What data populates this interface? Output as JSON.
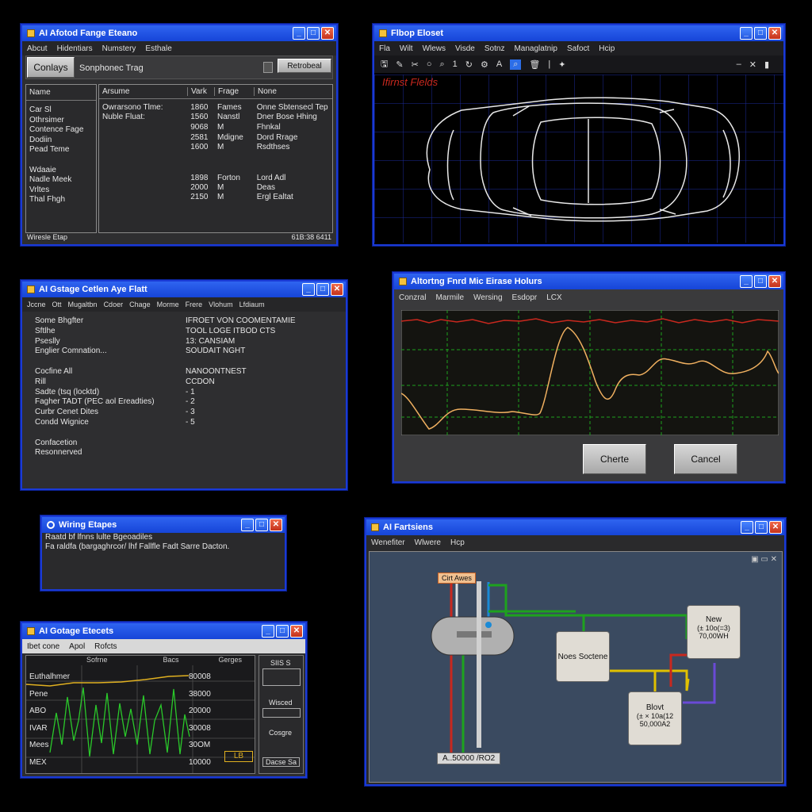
{
  "w1": {
    "title": "AI Afotod Fange Eteano",
    "menu": [
      "Abcut",
      "Hidentiars",
      "Numstery",
      "Esthale"
    ],
    "tab_left": "Conlays",
    "tab_mid": "Sonphonec Trag",
    "tab_right": "Retrobeal",
    "col_name": "Name",
    "list_left": [
      "Car Sl",
      "Othrsimer",
      "Contence Fage",
      "Dodiin",
      "Pead Teme",
      "",
      "Wdaaie",
      "Nadle Meek",
      "Vrltes",
      "Thal Fhgh"
    ],
    "headers": [
      "Arsume",
      "Vark",
      "Frage",
      "None"
    ],
    "rows": [
      [
        "Owrarsono Tlme:",
        "1860",
        "Fames",
        "Onne Sbtensecl Tep"
      ],
      [
        "Nuble Fluat:",
        "1560",
        "Nanstl",
        "Dner Bose Hhing"
      ],
      [
        "",
        "9068",
        "M",
        "Fhnkal"
      ],
      [
        "",
        "2581",
        "Mdigne",
        "Dord Rrage"
      ],
      [
        "",
        "1600",
        "M",
        "Rsdthses"
      ],
      [
        "",
        "1898",
        "Forton",
        "Lord Adl"
      ],
      [
        "",
        "2000",
        "M",
        "Deas"
      ],
      [
        "",
        "2150",
        "M",
        "Ergl Ealtat"
      ]
    ],
    "status_left": "Wiresle Etap",
    "status_right": "61B:38 6411"
  },
  "w2": {
    "title": "Flbop Eloset",
    "menu": [
      "Fla",
      "Wilt",
      "Wlews",
      "Visde",
      "Sotnz",
      "Managlatnip",
      "Safoct",
      "Hcip"
    ],
    "label": "Ifirnst Flelds"
  },
  "w3": {
    "title": "AI Gstage Cetlen Aye Flatt",
    "menu": [
      "Jccne",
      "Ott",
      "Mugaltbn",
      "Cdoer",
      "Chage",
      "Morme",
      "Frere",
      "Vlohum",
      "Lfdiaum"
    ],
    "rows": [
      [
        "Some Bhgfter",
        "IFROET VON COOMENTAMIE"
      ],
      [
        "Sftlhe",
        "TOOL LOGE ITBOD CTS"
      ],
      [
        "Pseslly",
        "13: CANSIAM"
      ],
      [
        "Englier Comnation...",
        "SOUDAIT NGHT"
      ],
      [
        "",
        ""
      ],
      [
        "Cocfine All",
        "NANOONTNEST"
      ],
      [
        "Rill",
        "CCDON"
      ],
      [
        "Sadte (tsq (locktd)",
        "- 1"
      ],
      [
        "Fagher TADT (PEC aol Ereadties)",
        "- 2"
      ],
      [
        "Curbr Cenet Dites",
        "- 3"
      ],
      [
        "Condd Wignice",
        "- 5"
      ],
      [
        "",
        ""
      ],
      [
        "Confacetion",
        ""
      ],
      [
        "Resonnerved",
        ""
      ]
    ]
  },
  "w4": {
    "title": "Altortng Fnrd Mic Eirase Holurs",
    "menu": [
      "Conzral",
      "Marmile",
      "Wersing",
      "Esdopr",
      "LCX"
    ],
    "ok_label": "Cherte",
    "cancel_label": "Cancel"
  },
  "w5": {
    "title": "Wiring Etapes",
    "line1": "Raatd  bf lfnns lulte Bgeoadiles",
    "line2": "Fa raldfa (bargaghrcor/ lhf Fallfle Fadt Sarre Dacton."
  },
  "w6": {
    "title": "AI Fartsiens",
    "menu": [
      "Wenefiter",
      "Wlwere",
      "Hcp"
    ],
    "top_label": "Cirt Awes",
    "box1": "Noes Soctene",
    "box2_l1": "New",
    "box2_l2": "(± 10o(=3)",
    "box2_l3": "70,00WH",
    "box3_l1": "Blovt",
    "box3_l2": "(± × 10a(12",
    "box3_l3": "50,000A2",
    "bottom_label": "A..50000 /RO2"
  },
  "w7": {
    "title": "AI Gotage Etecets",
    "menu": [
      "Ibet cone",
      "Apol",
      "Rofcts"
    ],
    "col_headers": [
      "Sofrne",
      "Bacs",
      "Gerges"
    ],
    "left_labels": [
      "Euthalhmer",
      "Pene",
      "ABO",
      "IVAR",
      "Mees",
      "MEX"
    ],
    "values": [
      "80008",
      "38000",
      "20000",
      "30008",
      "30OM",
      "10000"
    ],
    "lb": "LB",
    "right": [
      "SIIS S",
      "Wisced",
      "Cosgre",
      "Dacse Sa"
    ]
  }
}
